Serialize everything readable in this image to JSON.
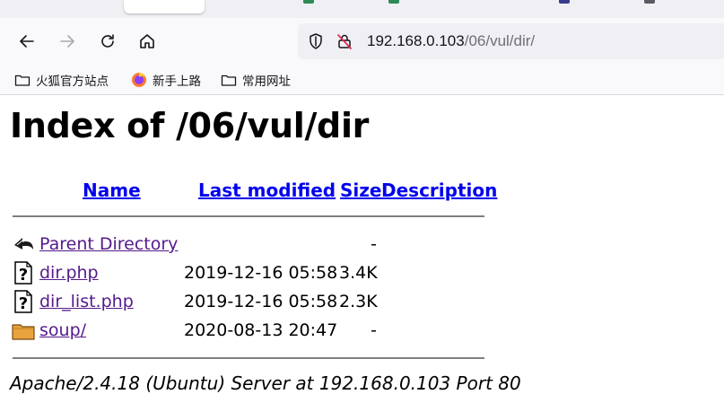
{
  "browser": {
    "address": {
      "host": "192.168.0.103",
      "path": "/06/vul/dir/"
    },
    "bookmarks": [
      {
        "label": "火狐官方站点",
        "icon": "folder-icon"
      },
      {
        "label": "新手上路",
        "icon": "firefox-icon"
      },
      {
        "label": "常用网址",
        "icon": "folder-icon"
      }
    ]
  },
  "page": {
    "title": "Index of /06/vul/dir",
    "columns": {
      "name": "Name",
      "last_modified": "Last modified",
      "size": "Size",
      "description": "Description"
    },
    "rows": [
      {
        "name": "Parent Directory",
        "modified": "",
        "size": "-",
        "icon": "back-arrow-icon"
      },
      {
        "name": "dir.php",
        "modified": "2019-12-16 05:58",
        "size": "3.4K",
        "icon": "unknown-file-icon"
      },
      {
        "name": "dir_list.php",
        "modified": "2019-12-16 05:58",
        "size": "2.3K",
        "icon": "unknown-file-icon"
      },
      {
        "name": "soup/",
        "modified": "2020-08-13 20:47",
        "size": "-",
        "icon": "folder-icon"
      }
    ],
    "footer": "Apache/2.4.18 (Ubuntu) Server at 192.168.0.103 Port 80"
  },
  "colors": {
    "link": "#0000ee",
    "visited": "#551a8b",
    "chrome": "#f9f9fb",
    "tabstrip": "#f0f0f4"
  }
}
